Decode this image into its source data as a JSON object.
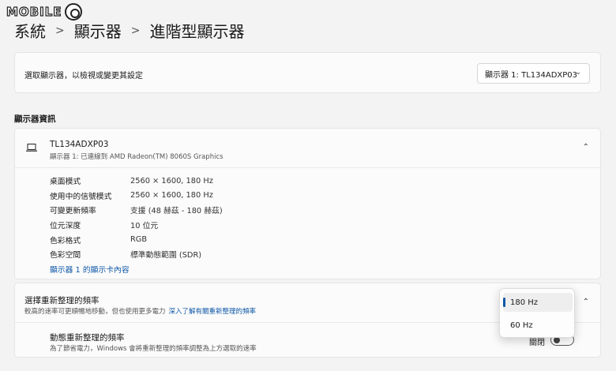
{
  "watermark": {
    "text": "MOBILE"
  },
  "breadcrumb": {
    "items": [
      "系統",
      "顯示器",
      "進階型顯示器"
    ],
    "separator": ">"
  },
  "display_select": {
    "label": "選取顯示器，以檢視或變更其設定",
    "selected": "顯示器 1: TL134ADXP03"
  },
  "info_section": {
    "title": "顯示器資訊",
    "monitor_name": "TL134ADXP03",
    "monitor_sub": "顯示器 1: 已連線到 AMD Radeon(TM) 8060S Graphics",
    "rows": [
      {
        "key": "桌面模式",
        "value": "2560 × 1600, 180 Hz"
      },
      {
        "key": "使用中的信號模式",
        "value": "2560 × 1600, 180 Hz"
      },
      {
        "key": "可變更新頻率",
        "value": "支援 (48 赫茲 - 180 赫茲)"
      },
      {
        "key": "位元深度",
        "value": "10 位元"
      },
      {
        "key": "色彩格式",
        "value": "RGB"
      },
      {
        "key": "色彩空間",
        "value": "標準動態範圍 (SDR)"
      }
    ],
    "adapter_link": "顯示器 1 的顯示卡內容"
  },
  "refresh": {
    "title": "選擇重新整理的頻率",
    "subtitle": "較高的速率可更順暢地移動，但也使用更多電力",
    "inline_link": "深入了解有關重新整理的頻率",
    "options": [
      "180 Hz",
      "60 Hz"
    ],
    "selected_index": 0,
    "dynamic_title": "動態重新整理的頻率",
    "dynamic_sub": "為了節省電力，Windows 會將重新整理的頻率調整為上方選取的速率",
    "dynamic_state": "關閉"
  }
}
